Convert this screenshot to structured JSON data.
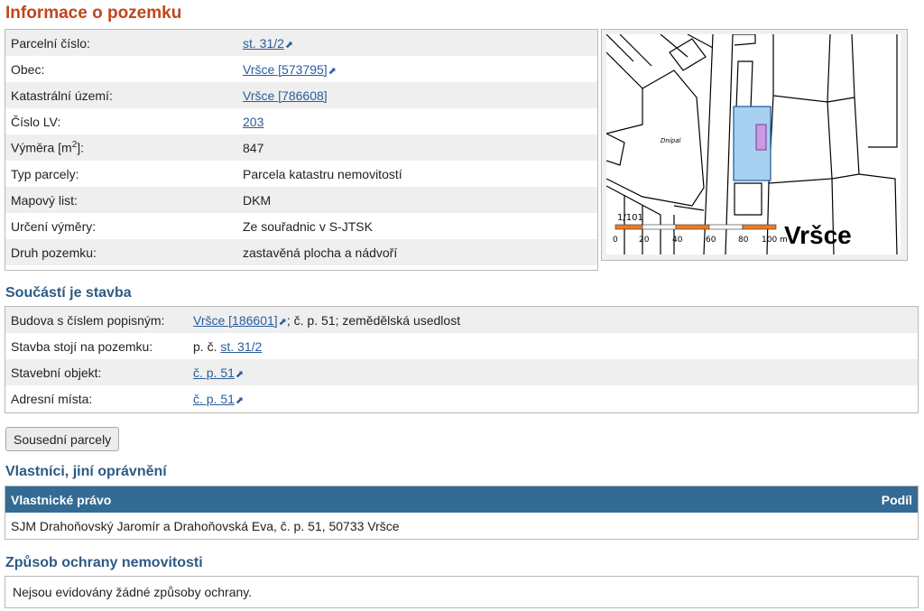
{
  "title": "Informace o pozemku",
  "pozemek": {
    "rows": [
      {
        "label": "Parcelní číslo:",
        "value": "st. 31/2",
        "ext": "⬈"
      },
      {
        "label": "Obec:",
        "value": "Vršce [573795]",
        "ext": "⬈"
      },
      {
        "label": "Katastrální území:",
        "value": "Vršce [786608]"
      },
      {
        "label": "Číslo LV:",
        "value": "203"
      },
      {
        "label_pre": "Výměra [m",
        "label_sup": "2",
        "label_post": "]:",
        "value": "847"
      },
      {
        "label": "Typ parcely:",
        "value": "Parcela katastru nemovitostí"
      },
      {
        "label": "Mapový list:",
        "value": "DKM"
      },
      {
        "label": "Určení výměry:",
        "value": "Ze souřadnic v S-JTSK"
      },
      {
        "label": "Druh pozemku:",
        "value": "zastavěná plocha a nádvoří"
      }
    ]
  },
  "map": {
    "place_label": "Vršce",
    "small_label": "Dnípal",
    "parcel_label": "1/101",
    "scale_labels": [
      "0",
      "20",
      "40",
      "60",
      "80",
      "100 m"
    ],
    "colors": {
      "parcel_fill": "#a8d0f0",
      "building_fill": "#c89be0",
      "scale_orange": "#f07a20"
    }
  },
  "stavba": {
    "heading": "Součástí je stavba",
    "rows": [
      {
        "label": "Budova s číslem popisným:",
        "link": "Vršce [186601]",
        "ext": "⬈",
        "rest": "; č. p. 51; zemědělská usedlost"
      },
      {
        "label": "Stavba stojí na pozemku:",
        "prefix": "p. č. ",
        "link": "st. 31/2"
      },
      {
        "label": "Stavební objekt:",
        "link": "č. p. 51",
        "ext": "⬈"
      },
      {
        "label": "Adresní místa:",
        "link": "č. p. 51",
        "ext": "⬈"
      }
    ]
  },
  "buttons": {
    "sousedni": "Sousední parcely"
  },
  "vlastnici": {
    "heading": "Vlastníci, jiní oprávnění",
    "col_left": "Vlastnické právo",
    "col_right": "Podíl",
    "row": "SJM Drahoňovský Jaromír a Drahoňovská Eva, č. p. 51, 50733 Vršce"
  },
  "ochrana": {
    "heading": "Způsob ochrany nemovitosti",
    "text": "Nejsou evidovány žádné způsoby ochrany."
  }
}
